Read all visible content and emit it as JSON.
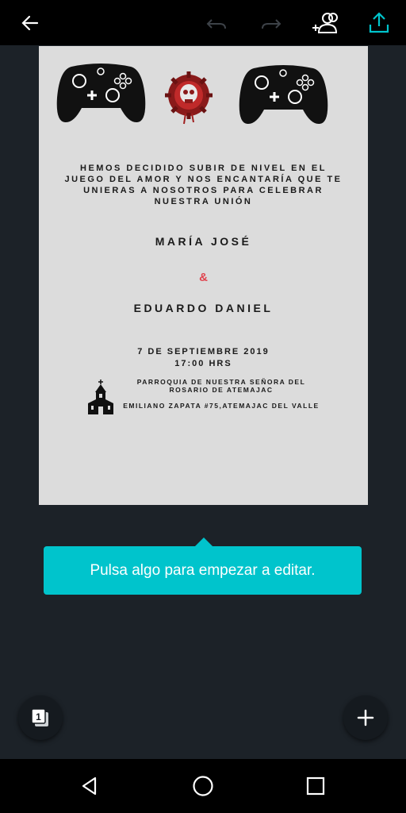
{
  "toolbar": {
    "back_icon": "arrow-left-icon",
    "undo_icon": "undo-icon",
    "redo_icon": "redo-icon",
    "share_people_icon": "add-people-icon",
    "export_icon": "upload-icon"
  },
  "invitation": {
    "intro": "HEMOS DECIDIDO SUBIR DE NIVEL EN EL JUEGO DEL AMOR Y NOS ENCANTARÍA QUE TE UNIERAS A NOSOTROS PARA CELEBRAR NUESTRA UNIÓN",
    "name_one": "MARÍA JOSÉ",
    "ampersand": "&",
    "name_two": "EDUARDO DANIEL",
    "date": "7 DE SEPTIEMBRE 2019",
    "time": "17:00 HRS",
    "parish": "PARROQUIA DE NUESTRA SEÑORA DEL ROSARIO DE ATEMAJAC",
    "address": "EMILIANO ZAPATA #75,ATEMAJAC DEL VALLE"
  },
  "tooltip": {
    "text": "Pulsa algo para empezar a editar."
  },
  "pages_fab": {
    "count": "1"
  },
  "colors": {
    "accent": "#00c4cc",
    "ampersand": "#e0444e",
    "background": "#1c2228"
  }
}
